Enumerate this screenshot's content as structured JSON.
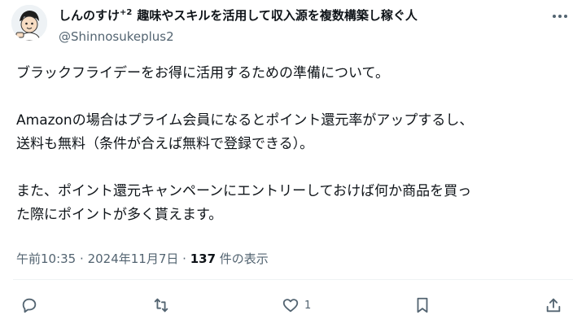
{
  "post": {
    "author_name": "しんのすけ",
    "author_sup": "+2",
    "author_bio": "趣味やスキルを活用して収入源を複数構築し稼ぐ人",
    "handle": "@Shinnosukeplus2",
    "lines": [
      "ブラックフライデーをお得に活用するための準備について。",
      "",
      "Amazonの場合はプライム会員になるとポイント還元率がアップするし、",
      "送料も無料（条件が合えば無料で登録できる）。",
      "",
      "また、ポイント還元キャンペーンにエントリーしておけば何か商品を買っ",
      "た際にポイントが多く貰えます。"
    ],
    "time": "午前10:35",
    "date": "2024年11月7日",
    "views_count": "137",
    "views_label": "件の表示"
  },
  "actions": {
    "like_count": "1"
  },
  "icons": {
    "reply": "reply-icon",
    "repost": "repost-icon",
    "like": "heart-icon",
    "bookmark": "bookmark-icon",
    "share": "share-icon",
    "more": "more-icon"
  }
}
